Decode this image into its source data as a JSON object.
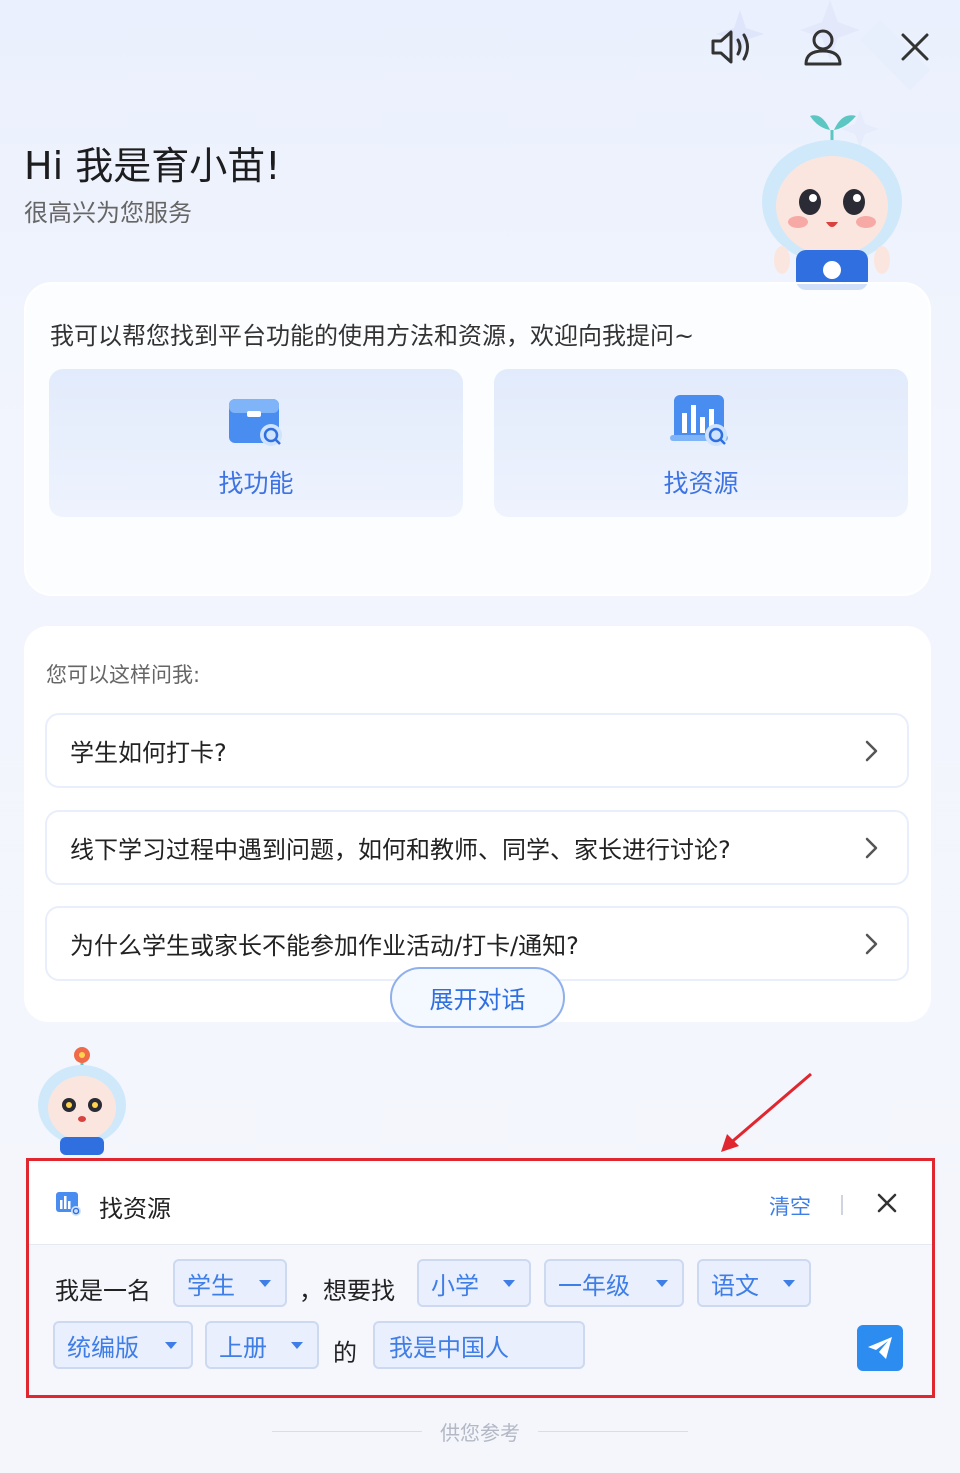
{
  "header": {
    "title": "Hi 我是育小苗!",
    "subtitle": "很高兴为您服务"
  },
  "intro_card": {
    "intro_text": "我可以帮您找到平台功能的使用方法和资源，欢迎向我提问~",
    "features": [
      {
        "label": "找功能",
        "icon": "box-search-icon"
      },
      {
        "label": "找资源",
        "icon": "chart-search-icon"
      }
    ]
  },
  "suggest_card": {
    "title": "您可以这样问我:",
    "questions": [
      "学生如何打卡?",
      "线下学习过程中遇到问题，如何和教师、同学、家长进行讨论?",
      "为什么学生或家长不能参加作业活动/打卡/通知?"
    ],
    "expand_label": "展开对话"
  },
  "resource_panel": {
    "title": "找资源",
    "clear_label": "清空",
    "text_prefix": "我是一名",
    "text_want": "，想要找",
    "text_of": "的",
    "role_value": "学生",
    "stage_value": "小学",
    "grade_value": "一年级",
    "subject_value": "语文",
    "edition_value": "统编版",
    "volume_value": "上册",
    "keyword_value": "我是中国人",
    "highlight_color": "#e0262e"
  },
  "footer": {
    "note": "供您参考"
  },
  "colors": {
    "accent": "#3e7ee6",
    "send": "#2d8cf0"
  }
}
